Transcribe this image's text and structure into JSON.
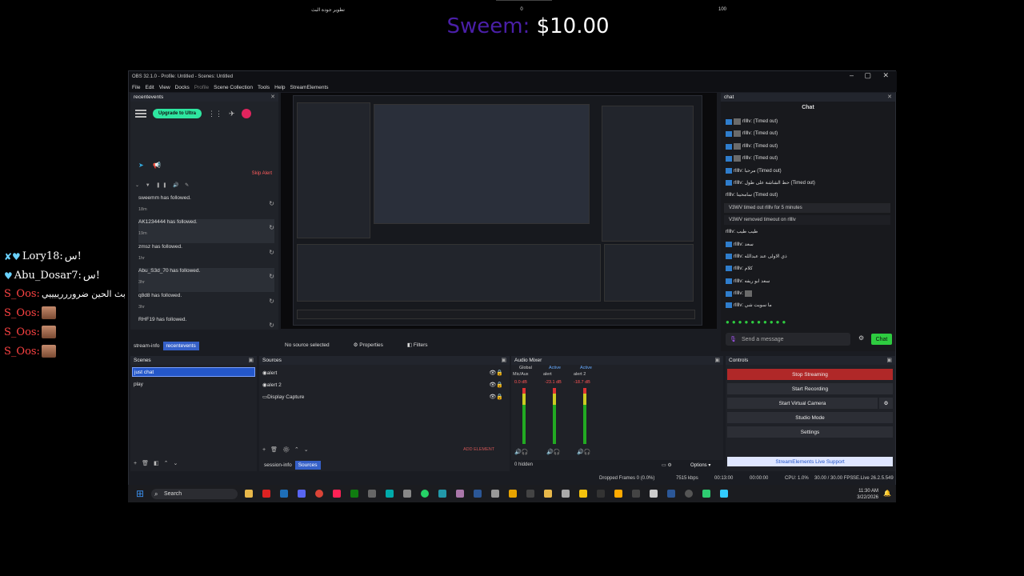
{
  "overlay": {
    "goal_left": "تطوير جودة البث",
    "goal_mid": "0",
    "goal_right": "100",
    "donation_name": "Sweem:",
    "donation_amount": "$10.00",
    "chat": [
      {
        "name": "Lory18:",
        "message": "س!"
      },
      {
        "name": "Abu_Dosar7:",
        "message": "س!"
      },
      {
        "name": "S_Oos:",
        "message": "ابيد افتح بث الحين ضرورررييييي"
      },
      {
        "name": "S_Oos:",
        "message": ""
      },
      {
        "name": "S_Oos:",
        "message": ""
      },
      {
        "name": "S_Oos:",
        "message": ""
      }
    ]
  },
  "window": {
    "title": "OBS 32.1.0 - Profile: Untitled - Scenes: Untitled",
    "menu": [
      "File",
      "Edit",
      "View",
      "Docks",
      "Profile",
      "Scene Collection",
      "Tools",
      "Help",
      "StreamElements"
    ]
  },
  "recent_events": {
    "title": "recentevents",
    "upgrade_label": "Upgrade to Ultra",
    "skip_alert": "Skip Alert",
    "events": [
      {
        "text": "sweemm has followed.",
        "time": "18m"
      },
      {
        "text": "AK1234444 has followed.",
        "time": "19m"
      },
      {
        "text": "zmsz has followed.",
        "time": "1hr"
      },
      {
        "text": "Abu_S3d_70 has followed.",
        "time": "3hr"
      },
      {
        "text": "q8d8 has followed.",
        "time": "3hr"
      },
      {
        "text": "RHF19 has followed.",
        "time": "3hr"
      }
    ],
    "tabs": [
      "stream-info",
      "recentevents"
    ]
  },
  "source_bar": {
    "status": "No source selected",
    "properties": "Properties",
    "filters": "Filters"
  },
  "chat": {
    "dock_title": "chat",
    "header": "Chat",
    "lines": [
      "rllllv: (Timed out)",
      "rllllv: (Timed out)",
      "rllllv: (Timed out)",
      "rllllv: (Timed out)",
      "rllllv: مرحبا (Timed out)",
      "rllllv: حط الشاشة على طول (Timed out)",
      "rllllv: سامحينا (Timed out)"
    ],
    "system": [
      "V3WV timed out rllllv for 5 minutes",
      "V3WV removed timeout on rllllv"
    ],
    "lines2": [
      "rllllv: طيب طيب",
      "rllllv: سعد",
      "rllllv: ذي الاولى عند عبدالله",
      "rllllv: كلام",
      "rllllv: سعد ابو ريفه",
      "rllllv:",
      "rllllv: ما سويت شي"
    ],
    "send_placeholder": "Send a message",
    "chat_button": "Chat"
  },
  "scenes": {
    "title": "Scenes",
    "items": [
      "just chat",
      "play"
    ]
  },
  "sources": {
    "title": "Sources",
    "items": [
      "alert",
      "alert 2",
      "Display Capture"
    ],
    "add_element": "ADD ELEMENT",
    "tabs": [
      "session-info",
      "Sources"
    ]
  },
  "mixer": {
    "title": "Audio Mixer",
    "tabs": [
      "Global",
      "Active",
      "Active"
    ],
    "channels": [
      {
        "name": "Mic/Aux",
        "db": "0.0 dB"
      },
      {
        "name": "alert",
        "db": "-23.1 dB"
      },
      {
        "name": "alert 2",
        "db": "-18.7 dB"
      }
    ],
    "hidden": "0 hidden",
    "options": "Options"
  },
  "controls": {
    "title": "Controls",
    "buttons": [
      "Stop Streaming",
      "Start Recording",
      "Start Virtual Camera",
      "Studio Mode",
      "Settings"
    ],
    "support": "StreamElements Live Support"
  },
  "status": {
    "dropped": "Dropped Frames 0 (0.0%)",
    "kbps": "7515 kbps",
    "time": "00:13:00",
    "rec": "00:00:00",
    "cpu": "CPU: 1.0%",
    "fps": "30.00 / 30.00 FPS",
    "version": "SE.Live 26.2.5.549"
  },
  "taskbar": {
    "search": "Search",
    "time": "11:30 AM",
    "date": "3/22/2026"
  },
  "colors": {
    "accent": "#2457c9",
    "stop": "#b02828",
    "upgrade": "#2ee6a0",
    "chat_button": "#2ecc40",
    "donation_name": "#4a1fa8"
  }
}
